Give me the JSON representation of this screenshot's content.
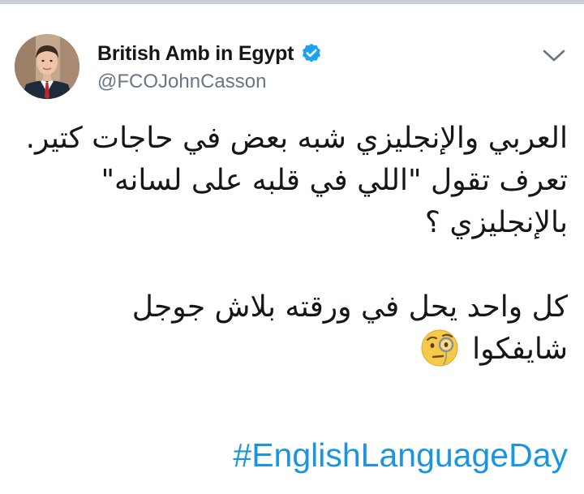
{
  "tweet": {
    "author": {
      "display_name": "British Amb in Egypt",
      "handle": "@FCOJohnCasson",
      "verified": true,
      "avatar_icon": "avatar-photo"
    },
    "menu_icon": "chevron-down-icon",
    "body_lines": [
      "العربي والإنجليزي شبه بعض في حاجات كتير.",
      "تعرف تقول \"اللي في قلبه على لسانه\"",
      "بالإنجليزي ؟",
      "",
      "كل واحد يحل في ورقته بلاش جوجل",
      "شايفكوا"
    ],
    "emoji": "face-with-monocle",
    "hashtag": "#EnglishLanguageDay"
  },
  "colors": {
    "link": "#1b95e0",
    "secondary_text": "#657786",
    "verified_badge": "#1da1f2",
    "divider": "#c8cdd1"
  }
}
